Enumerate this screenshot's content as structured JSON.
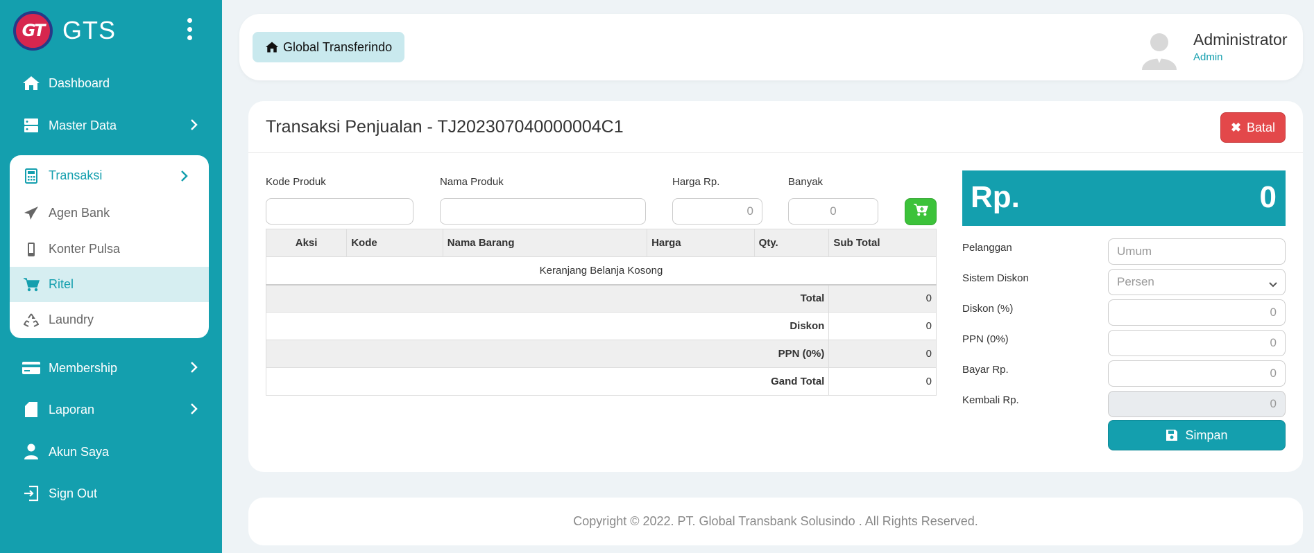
{
  "brand": {
    "logo_text": "GT",
    "name": "GTS"
  },
  "sidebar": {
    "items": [
      {
        "label": "Dashboard",
        "icon": "home-icon"
      },
      {
        "label": "Master Data",
        "icon": "server-icon"
      },
      {
        "label": "Transaksi",
        "icon": "calculator-icon"
      },
      {
        "label": "Membership",
        "icon": "credit-card-icon"
      },
      {
        "label": "Laporan",
        "icon": "file-icon"
      },
      {
        "label": "Akun Saya",
        "icon": "user-icon"
      },
      {
        "label": "Sign Out",
        "icon": "sign-out-icon"
      }
    ],
    "transaksi_sub": [
      {
        "label": "Agen Bank",
        "icon": "paper-plane-icon"
      },
      {
        "label": "Konter Pulsa",
        "icon": "mobile-icon"
      },
      {
        "label": "Ritel",
        "icon": "cart-icon"
      },
      {
        "label": "Laundry",
        "icon": "recycle-icon"
      }
    ]
  },
  "header": {
    "breadcrumb": "Global Transferindo",
    "user_name": "Administrator",
    "user_role": "Admin"
  },
  "main": {
    "title": "Transaksi Penjualan - TJ202307040000004C1",
    "cancel_label": "Batal",
    "form": {
      "kode_label": "Kode Produk",
      "kode_value": "",
      "nama_label": "Nama Produk",
      "nama_value": "",
      "harga_label": "Harga Rp.",
      "harga_placeholder": "0",
      "banyak_label": "Banyak",
      "banyak_placeholder": "0"
    },
    "table": {
      "columns": [
        "Aksi",
        "Kode",
        "Nama Barang",
        "Harga",
        "Qty.",
        "Sub Total"
      ],
      "empty_message": "Keranjang Belanja Kosong",
      "summary": [
        {
          "label": "Total",
          "value": "0"
        },
        {
          "label": "Diskon",
          "value": "0"
        },
        {
          "label": "PPN (0%)",
          "value": "0"
        },
        {
          "label": "Gand Total",
          "value": "0"
        }
      ]
    },
    "payment": {
      "currency": "Rp.",
      "amount": "0",
      "pelanggan_label": "Pelanggan",
      "pelanggan_placeholder": "Umum",
      "sistem_diskon_label": "Sistem Diskon",
      "sistem_diskon_value": "Persen",
      "diskon_label": "Diskon (%)",
      "diskon_placeholder": "0",
      "ppn_label": "PPN (0%)",
      "ppn_placeholder": "0",
      "bayar_label": "Bayar Rp.",
      "bayar_placeholder": "0",
      "kembali_label": "Kembali Rp.",
      "kembali_placeholder": "0",
      "save_label": "Simpan"
    }
  },
  "footer": {
    "text": "Copyright © 2022. PT. Global Transbank Solusindo . All Rights Reserved."
  },
  "colors": {
    "primary": "#149fae",
    "danger": "#e3484a",
    "success": "#3cc23a"
  }
}
